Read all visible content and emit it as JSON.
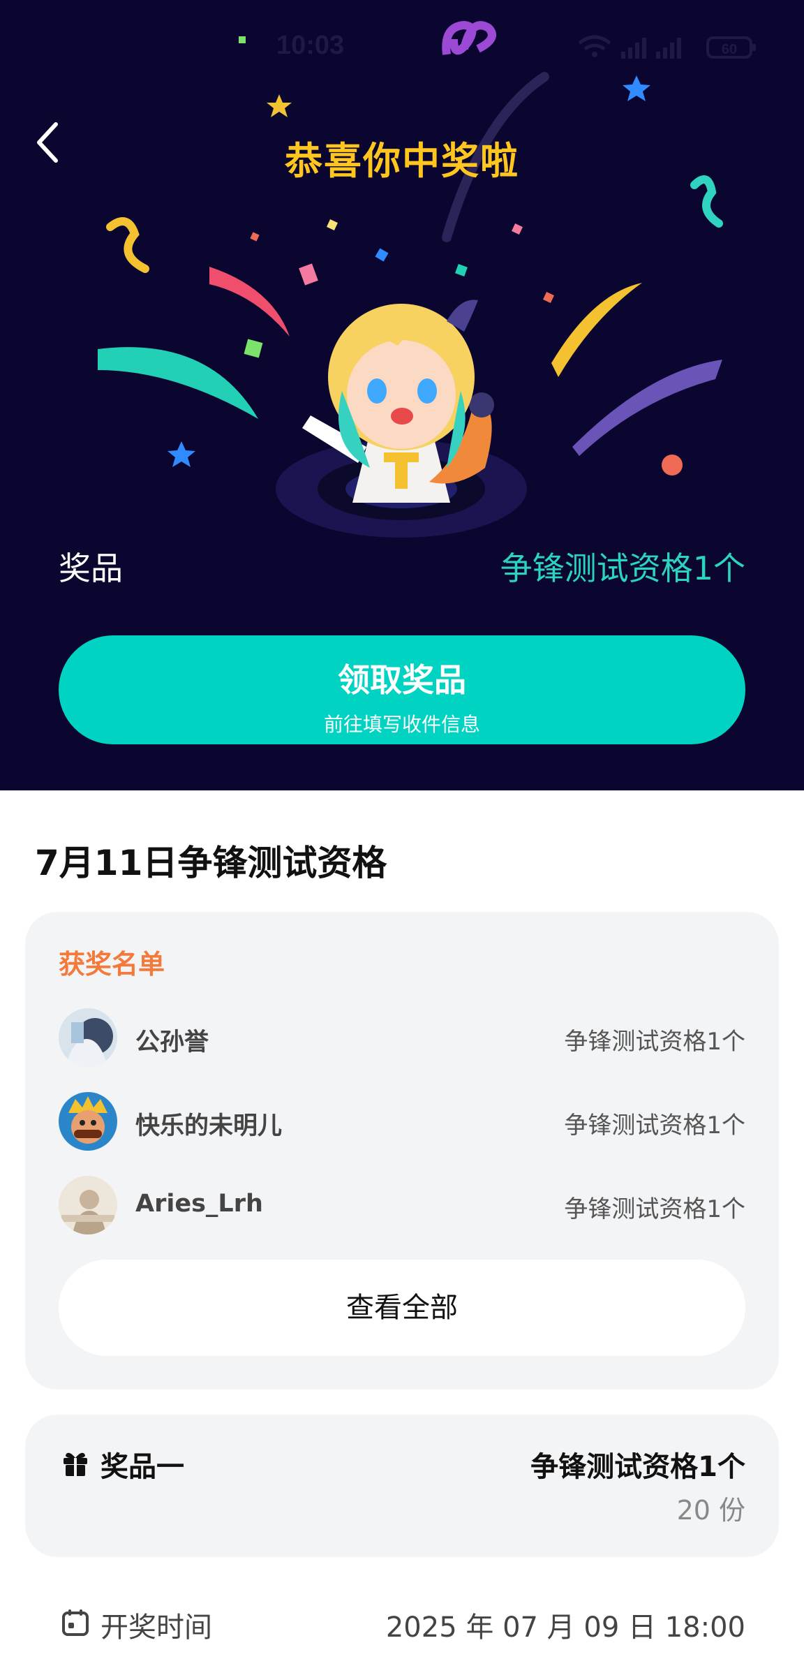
{
  "status_bar": {
    "time": "10:03",
    "battery": "60"
  },
  "header": {
    "title": "恭喜你中奖啦"
  },
  "prize_summary": {
    "label": "奖品",
    "value": "争锋测试资格1个"
  },
  "claim_button": {
    "label": "领取奖品",
    "sublabel": "前往填写收件信息"
  },
  "event": {
    "title": "7月11日争锋测试资格"
  },
  "winners": {
    "heading": "获奖名单",
    "items": [
      {
        "name": "公孙誉",
        "prize": "争锋测试资格1个"
      },
      {
        "name": "快乐的未明儿",
        "prize": "争锋测试资格1个"
      },
      {
        "name": "Aries_Lrh",
        "prize": "争锋测试资格1个"
      }
    ],
    "view_all_label": "查看全部"
  },
  "prize_detail": {
    "name": "奖品一",
    "item": "争锋测试资格1个",
    "count": "20 份"
  },
  "draw_info": {
    "label": "开奖时间",
    "time": "2025 年 07 月 09 日 18:00"
  },
  "colors": {
    "hero_background": "#0a0630",
    "accent_teal": "#00d3c2",
    "title_yellow": "#ffc61f",
    "heading_orange": "#f47a3b"
  }
}
